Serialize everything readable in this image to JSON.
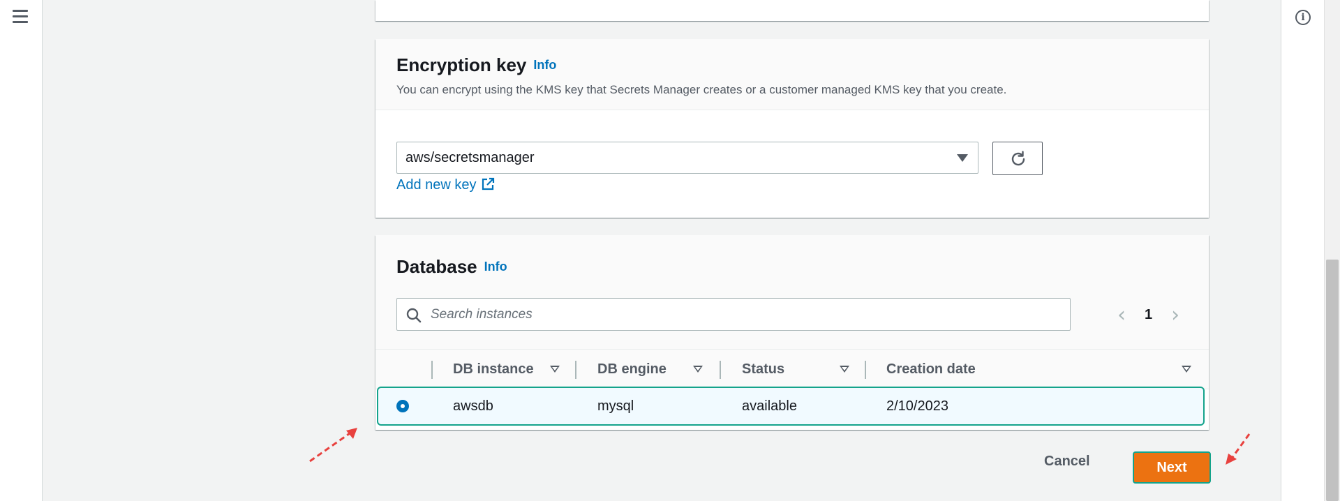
{
  "encryption": {
    "title": "Encryption key",
    "info": "Info",
    "description": "You can encrypt using the KMS key that Secrets Manager creates or a customer managed KMS key that you create.",
    "selected_key": "aws/secretsmanager",
    "add_key_link": "Add new key"
  },
  "database": {
    "title": "Database",
    "info": "Info",
    "search_placeholder": "Search instances",
    "pagination": {
      "current_page": "1"
    },
    "columns": [
      "DB instance",
      "DB engine",
      "Status",
      "Creation date"
    ],
    "rows": [
      {
        "instance": "awsdb",
        "engine": "mysql",
        "status": "available",
        "created": "2/10/2023",
        "selected": true
      }
    ]
  },
  "footer": {
    "cancel_label": "Cancel",
    "next_label": "Next"
  },
  "colors": {
    "accent": "#0073bb",
    "primary_button": "#ec7211",
    "highlight_annotation": "#14a38b",
    "arrow_annotation": "#e8413e"
  },
  "icons": [
    "menu-icon",
    "info-icon",
    "caret-down-icon",
    "refresh-icon",
    "external-link-icon",
    "search-icon",
    "chevron-left-icon",
    "chevron-right-icon",
    "sort-icon"
  ]
}
